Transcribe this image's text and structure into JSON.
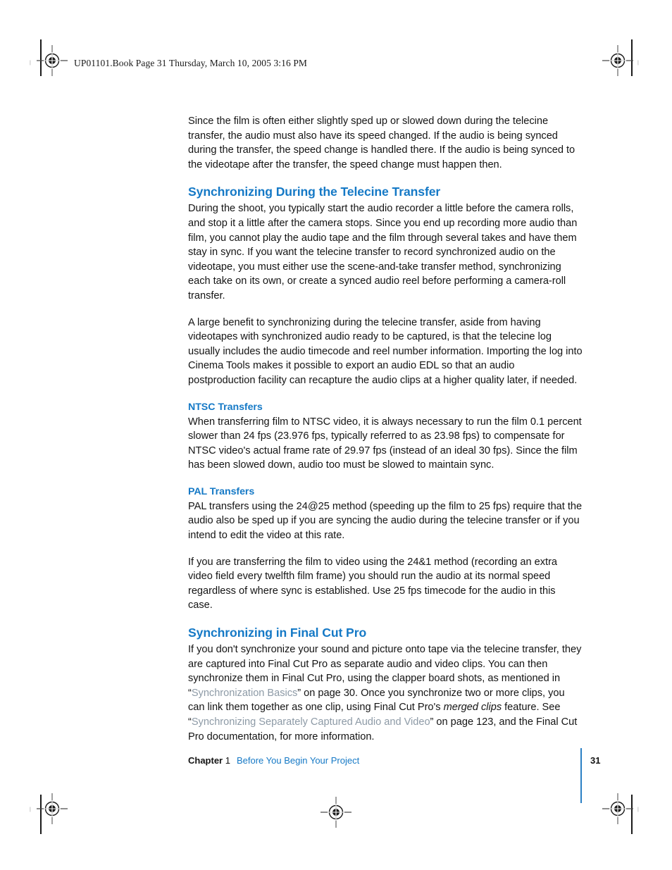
{
  "document": {
    "header_line": "UP01101.Book  Page 31  Thursday, March 10, 2005  3:16 PM",
    "accent_color": "#1579c6",
    "xref_color": "#8d9aa6",
    "body_color": "#141414"
  },
  "body": {
    "intro_paragraph": "Since the film is often either slightly sped up or slowed down during the telecine transfer, the audio must also have its speed changed. If the audio is being synced during the transfer, the speed change is handled there. If the audio is being synced to the videotape after the transfer, the speed change must happen then.",
    "section1": {
      "heading": "Synchronizing During the Telecine Transfer",
      "paragraph1": "During the shoot, you typically start the audio recorder a little before the camera rolls, and stop it a little after the camera stops. Since you end up recording more audio than film, you cannot play the audio tape and the film through several takes and have them stay in sync. If you want the telecine transfer to record synchronized audio on the videotape, you must either use the scene-and-take transfer method, synchronizing each take on its own, or create a synced audio reel before performing a camera-roll transfer.",
      "paragraph2": "A large benefit to synchronizing during the telecine transfer, aside from having videotapes with synchronized audio ready to be captured, is that the telecine log usually includes the audio timecode and reel number information. Importing the log into Cinema Tools makes it possible to export an audio EDL so that an audio postproduction facility can recapture the audio clips at a higher quality later, if needed.",
      "subsection_ntsc": {
        "heading": "NTSC Transfers",
        "paragraph": "When transferring film to NTSC video, it is always necessary to run the film 0.1 percent slower than 24 fps (23.976 fps, typically referred to as 23.98 fps) to compensate for NTSC video's actual frame rate of 29.97 fps (instead of an ideal 30 fps). Since the film has been slowed down, audio too must be slowed to maintain sync."
      },
      "subsection_pal": {
        "heading": "PAL Transfers",
        "paragraph1": "PAL transfers using the 24@25 method (speeding up the film to 25 fps) require that the audio also be sped up if you are syncing the audio during the telecine transfer or if you intend to edit the video at this rate.",
        "paragraph2": "If you are transferring the film to video using the 24&1 method (recording an extra video field every twelfth film frame) you should run the audio at its normal speed regardless of where sync is established. Use 25 fps timecode for the audio in this case."
      }
    },
    "section2": {
      "heading": "Synchronizing in Final Cut Pro",
      "part1": "If you don't synchronize your sound and picture onto tape via the telecine transfer, they are captured into Final Cut Pro as separate audio and video clips. You can then synchronize them in Final Cut Pro, using the clapper board shots, as mentioned in “",
      "xref1": "Synchronization Basics",
      "part2": "” on page 30. Once you synchronize two or more clips, you can link them together as one clip, using Final Cut Pro's ",
      "italic1": "merged clips",
      "part3": " feature. See “",
      "xref2": "Synchronizing Separately Captured Audio and Video",
      "part4": "” on page 123, and the Final Cut Pro documentation, for more information."
    }
  },
  "footer": {
    "chapter_word": "Chapter",
    "chapter_number": "1",
    "chapter_title": "Before You Begin Your Project",
    "page_number": "31"
  }
}
